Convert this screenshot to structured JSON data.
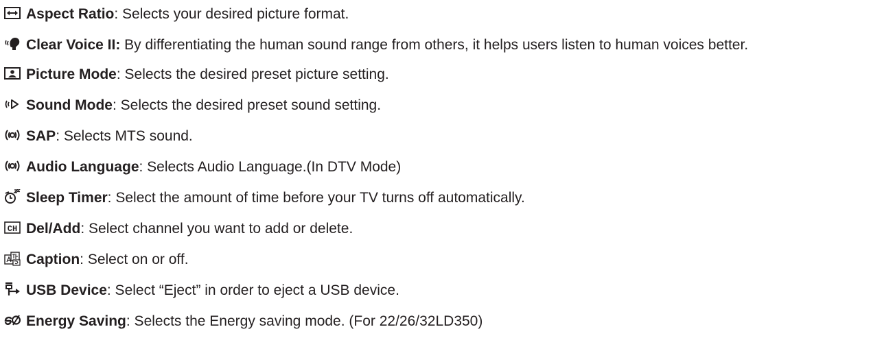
{
  "entries": [
    {
      "icon": "aspect-ratio-icon",
      "name": "Aspect Ratio",
      "desc": ": Selects your desired picture format."
    },
    {
      "icon": "clear-voice-icon",
      "name": "Clear Voice II:",
      "desc": " By differentiating the human sound range from others, it helps users listen to human voices better."
    },
    {
      "icon": "picture-mode-icon",
      "name": "Picture Mode",
      "desc": ": Selects the desired preset picture setting."
    },
    {
      "icon": "sound-mode-icon",
      "name": "Sound Mode",
      "desc": ": Selects the desired preset sound setting."
    },
    {
      "icon": "sap-icon",
      "name": "SAP",
      "desc": ": Selects MTS sound."
    },
    {
      "icon": "audio-language-icon",
      "name": "Audio Language",
      "desc": ": Selects Audio Language.(In DTV Mode)"
    },
    {
      "icon": "sleep-timer-icon",
      "name": "Sleep Timer",
      "desc": ": Select the amount of time before your TV turns off automatically."
    },
    {
      "icon": "ch-del-add-icon",
      "name": "Del/Add",
      "desc": ": Select channel you want to add or delete.",
      "icon_text": "CH"
    },
    {
      "icon": "caption-icon",
      "name": "Caption",
      "desc": ": Select on or off."
    },
    {
      "icon": "usb-device-icon",
      "name": "USB Device",
      "desc": ": Select “Eject” in order to eject a USB device."
    },
    {
      "icon": "energy-saving-icon",
      "name": "Energy Saving",
      "desc": ": Selects the Energy saving mode. (For 22/26/32LD350)"
    }
  ]
}
